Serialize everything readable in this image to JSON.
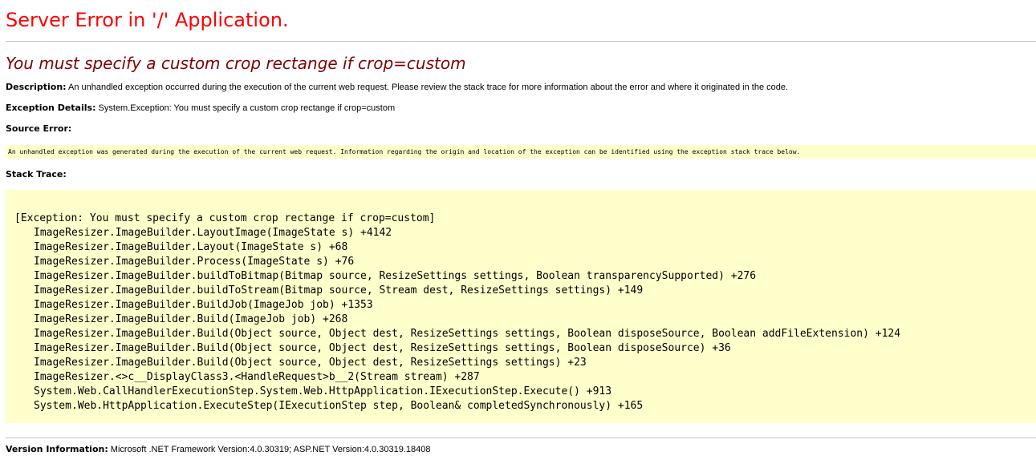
{
  "title": "Server Error in '/' Application.",
  "message": "You must specify a custom crop rectange if crop=custom",
  "description": {
    "label": "Description:",
    "text": "An unhandled exception occurred during the execution of the current web request. Please review the stack trace for more information about the error and where it originated in the code."
  },
  "exception_details": {
    "label": "Exception Details:",
    "text": "System.Exception: You must specify a custom crop rectange if crop=custom"
  },
  "source_error": {
    "label": "Source Error:",
    "text": "An unhandled exception was generated during the execution of the current web request. Information regarding the origin and location of the exception can be identified using the exception stack trace below."
  },
  "stack_trace": {
    "label": "Stack Trace:",
    "header": "[Exception: You must specify a custom crop rectange if crop=custom]",
    "frames": [
      "ImageResizer.ImageBuilder.LayoutImage(ImageState s) +4142",
      "ImageResizer.ImageBuilder.Layout(ImageState s) +68",
      "ImageResizer.ImageBuilder.Process(ImageState s) +76",
      "ImageResizer.ImageBuilder.buildToBitmap(Bitmap source, ResizeSettings settings, Boolean transparencySupported) +276",
      "ImageResizer.ImageBuilder.buildToStream(Bitmap source, Stream dest, ResizeSettings settings) +149",
      "ImageResizer.ImageBuilder.BuildJob(ImageJob job) +1353",
      "ImageResizer.ImageBuilder.Build(ImageJob job) +268",
      "ImageResizer.ImageBuilder.Build(Object source, Object dest, ResizeSettings settings, Boolean disposeSource, Boolean addFileExtension) +124",
      "ImageResizer.ImageBuilder.Build(Object source, Object dest, ResizeSettings settings, Boolean disposeSource) +36",
      "ImageResizer.ImageBuilder.Build(Object source, Object dest, ResizeSettings settings) +23",
      "ImageResizer.<>c__DisplayClass3.<HandleRequest>b__2(Stream stream) +287",
      "System.Web.CallHandlerExecutionStep.System.Web.HttpApplication.IExecutionStep.Execute() +913",
      "System.Web.HttpApplication.ExecuteStep(IExecutionStep step, Boolean& completedSynchronously) +165"
    ]
  },
  "version_info": {
    "label": "Version Information:",
    "text": "Microsoft .NET Framework Version:4.0.30319; ASP.NET Version:4.0.30319.18408"
  },
  "colors": {
    "title": "#ff0000",
    "message": "#800000",
    "code_background": "#ffffcc",
    "rule": "#c0c0c0"
  }
}
